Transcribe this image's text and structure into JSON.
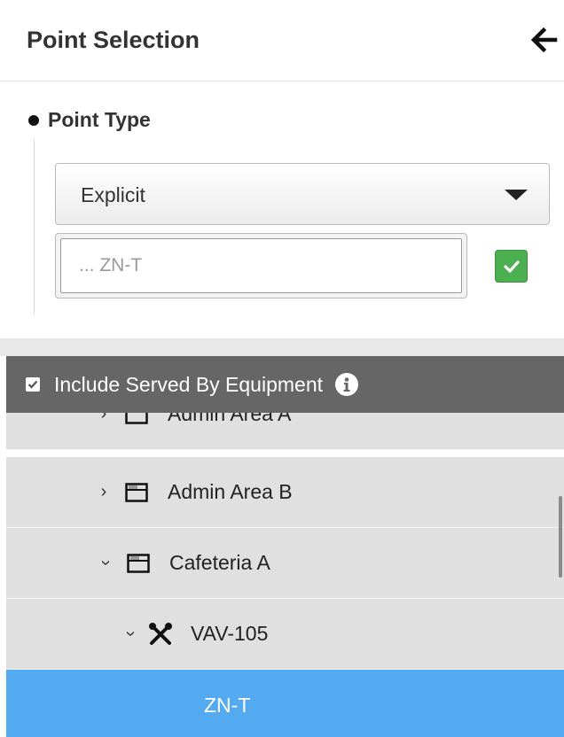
{
  "header": {
    "title": "Point Selection",
    "back_icon": "arrow-left-icon"
  },
  "point_type": {
    "label": "Point Type",
    "selected": "Explicit",
    "input_placeholder": "... ZN-T",
    "input_value": "",
    "confirm_icon": "checkmark-icon",
    "accent_color": "#4caf50"
  },
  "include_served": {
    "label": "Include Served By Equipment",
    "checked": true,
    "info_icon": "info-icon",
    "bar_color": "#666666"
  },
  "tree": {
    "items": [
      {
        "label": "Admin Area A",
        "expanded": false,
        "icon": "area-icon"
      },
      {
        "label": "Admin Area B",
        "expanded": false,
        "icon": "area-icon"
      },
      {
        "label": "Cafeteria A",
        "expanded": true,
        "icon": "area-icon"
      },
      {
        "label": "VAV-105",
        "expanded": true,
        "icon": "equipment-tools-icon"
      },
      {
        "label": "ZN-T",
        "selected": true,
        "selected_color": "#54aaf0"
      }
    ]
  }
}
